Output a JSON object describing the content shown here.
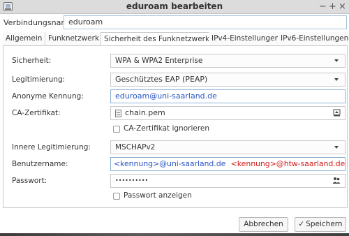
{
  "window": {
    "title": "eduroam bearbeiten",
    "minimize": "−",
    "maximize": "+",
    "close": "×"
  },
  "connection": {
    "name_label": "Verbindungsname:",
    "name_value": "eduroam"
  },
  "tabs": [
    {
      "label": "Allgemein"
    },
    {
      "label": "Funknetzwerk"
    },
    {
      "label": "Sicherheit des Funknetzwerks",
      "active": true
    },
    {
      "label": "IPv4-Einstellungen"
    },
    {
      "label": "IPv6-Einstellungen"
    }
  ],
  "security": {
    "security_label": "Sicherheit:",
    "security_value": "WPA & WPA2 Enterprise",
    "auth_label": "Legitimierung:",
    "auth_value": "Geschütztes EAP (PEAP)",
    "anon_label": "Anonyme Kennung:",
    "anon_value": "eduroam@uni-saarland.de",
    "ca_label": "CA-Zertifikat:",
    "ca_value": "chain.pem",
    "ca_ignore_label": "CA-Zertifikat ignorieren",
    "ca_ignore_checked": false,
    "inner_label": "Innere Legitimierung:",
    "inner_value": "MSCHAPv2",
    "user_label": "Benutzername:",
    "user_value_a": "<kennung>@uni-saarland.de",
    "user_value_b": "<kennung>@htw-saarland.de",
    "pass_label": "Passwort:",
    "pass_value": "••••••••••",
    "show_pass_label": "Passwort anzeigen",
    "show_pass_checked": false
  },
  "buttons": {
    "cancel": "Abbrechen",
    "save": "Speichern",
    "save_check": "✓"
  },
  "icons": {
    "app": "app-window-icon",
    "file": "file-icon",
    "eject": "eject-icon",
    "users": "users-icon"
  },
  "colors": {
    "highlight_blue": "#2a55c0",
    "highlight_red": "#d21a1a",
    "focus_border": "#8fb3d6"
  }
}
